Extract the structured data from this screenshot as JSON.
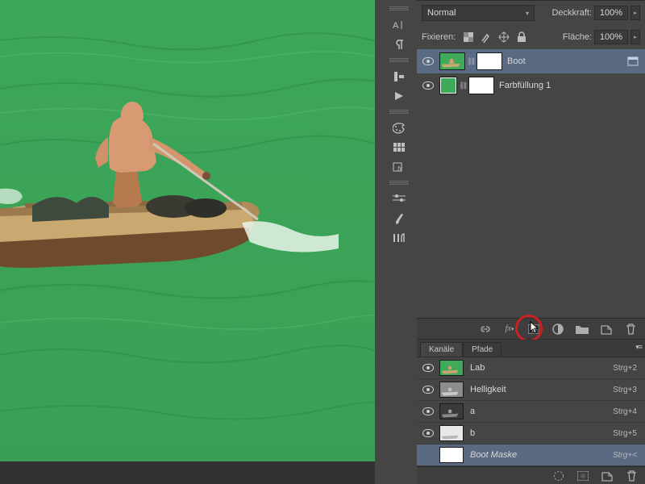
{
  "blend": {
    "mode": "Normal",
    "opacity_label": "Deckkraft:",
    "opacity_value": "100%",
    "fill_label": "Fläche:",
    "fill_value": "100%",
    "lock_label": "Fixieren:"
  },
  "layers": [
    {
      "name": "Boot",
      "selected": true,
      "hasMask": true,
      "thumbType": "boat"
    },
    {
      "name": "Farbfüllung 1",
      "selected": false,
      "hasMask": true,
      "thumbType": "green"
    }
  ],
  "channels_panel": {
    "tabs": [
      "Kanäle",
      "Pfade"
    ],
    "active_tab": 0,
    "channels": [
      {
        "name": "Lab",
        "shortcut": "Strg+2",
        "thumb": "lab"
      },
      {
        "name": "Helligkeit",
        "shortcut": "Strg+3",
        "thumb": "light"
      },
      {
        "name": "a",
        "shortcut": "Strg+4",
        "thumb": "a"
      },
      {
        "name": "b",
        "shortcut": "Strg+5",
        "thumb": "b"
      },
      {
        "name": "Boot Maske",
        "shortcut": "Strg+<",
        "thumb": "mask",
        "selected": true
      }
    ]
  }
}
